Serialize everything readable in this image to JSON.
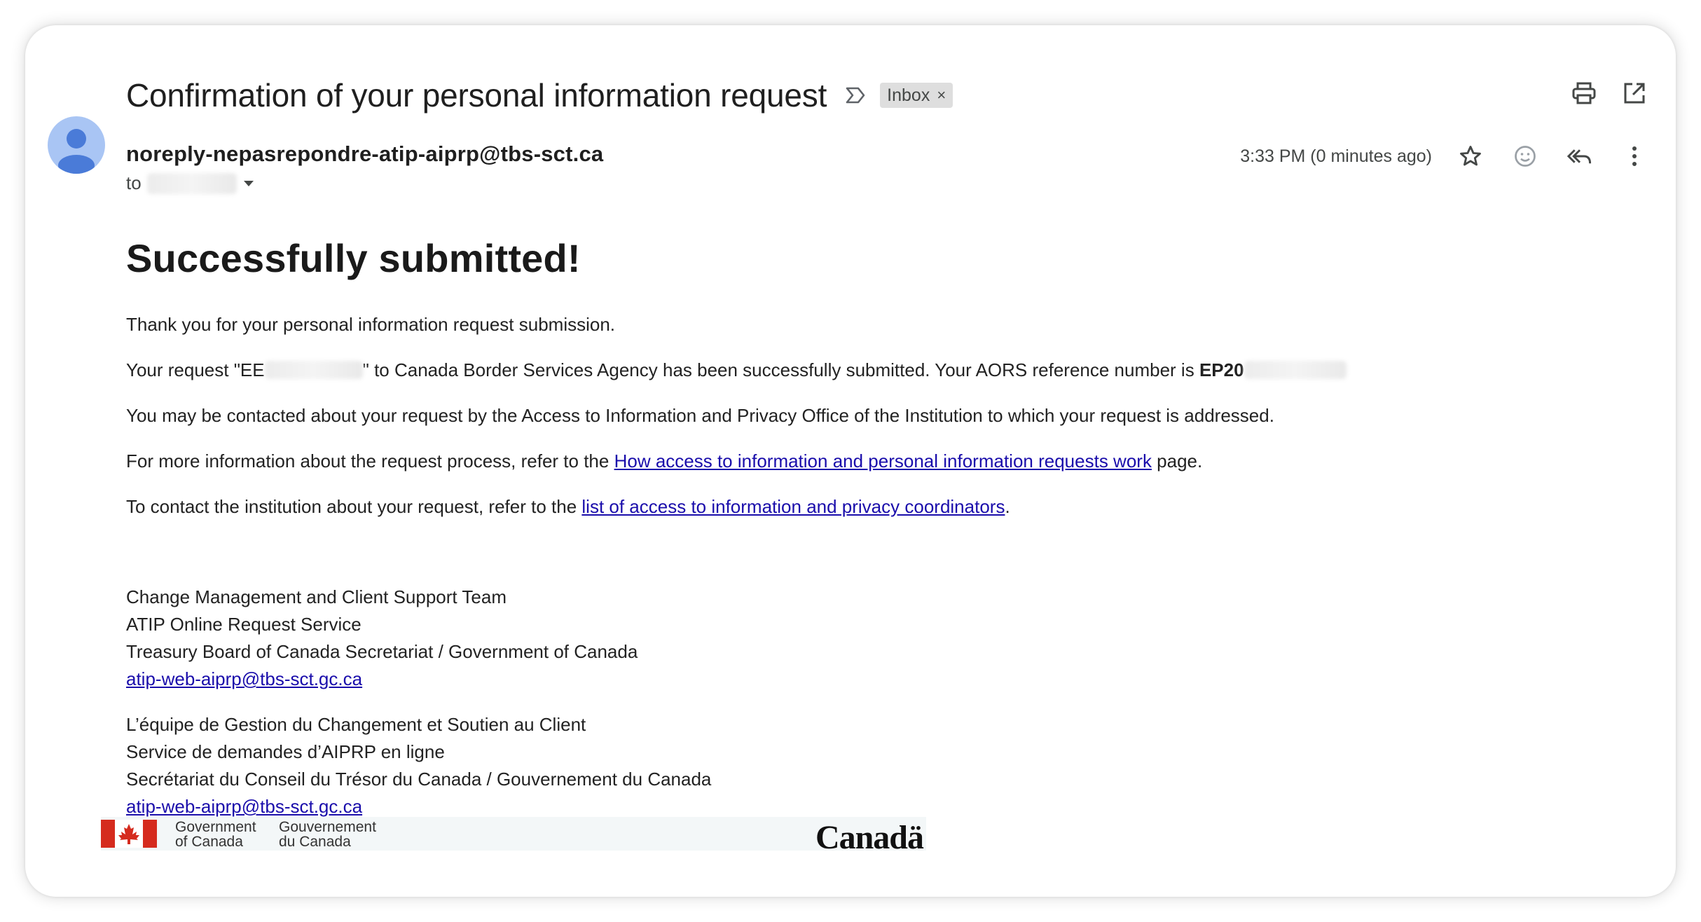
{
  "email": {
    "subject": "Confirmation of your personal information request",
    "label": "Inbox",
    "label_close": "×",
    "sender": "noreply-nepasrepondre-atip-aiprp@tbs-sct.ca",
    "to_label": "to",
    "time": "3:33 PM (0 minutes ago)"
  },
  "icons": {
    "importance": "importance-marker-icon",
    "print": "print-icon",
    "open_new_window": "open-in-new-window-icon",
    "star": "star-icon",
    "emoji": "emoji-reaction-icon",
    "reply_all": "reply-all-icon",
    "more": "more-vert-icon"
  },
  "content": {
    "headline": "Successfully submitted!",
    "p1": "Thank you for your personal information request submission.",
    "p2_prefix": "Your request \"EE",
    "p2_mid": "\" to Canada Border Services Agency has been successfully submitted. Your AORS reference number is ",
    "p2_ref": "EP20",
    "p3": "You may be contacted about your request by the Access to Information and Privacy Office of the Institution to which your request is addressed.",
    "p4_prefix": "For more information about the request process, refer to the ",
    "p4_link": "How access to information and personal information requests work",
    "p4_suffix": " page.",
    "p5_prefix": "To contact the institution about your request, refer to the ",
    "p5_link": "list of access to information and privacy coordinators",
    "p5_suffix": "."
  },
  "signature_en": {
    "line1": "Change Management and Client Support Team",
    "line2": "ATIP Online Request Service",
    "line3": "Treasury Board of Canada Secretariat / Government of Canada",
    "email": "atip-web-aiprp@tbs-sct.gc.ca"
  },
  "signature_fr": {
    "line1": "L’équipe de Gestion du Changement et Soutien au Client",
    "line2": "Service de demandes d’AIPRP en ligne",
    "line3": "Secrétariat du Conseil du Trésor du Canada / Gouvernement du Canada",
    "email": "atip-web-aiprp@tbs-sct.gc.ca"
  },
  "footer": {
    "gov_en_1": "Government",
    "gov_en_2": "of Canada",
    "gov_fr_1": "Gouvernement",
    "gov_fr_2": "du Canada",
    "wordmark": "Canadä"
  },
  "colors": {
    "link": "#1a0dab",
    "avatar_bg": "#a9c5f4",
    "avatar_fg": "#4a7bd8",
    "flag_red": "#d52b1e",
    "label_chip": "#dedede"
  }
}
